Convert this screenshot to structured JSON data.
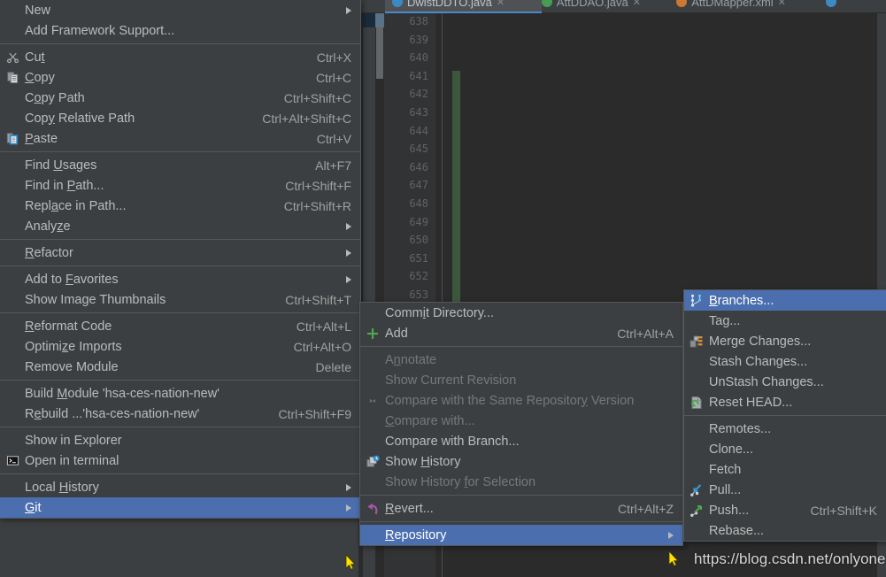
{
  "editor": {
    "tabs": [
      {
        "label": "DwistDDTO.java",
        "icon_color": "#3b8ac4",
        "active": true
      },
      {
        "label": "AttDDAO.java",
        "icon_color": "#499c54",
        "active": false
      },
      {
        "label": "AttDMapper.xml",
        "icon_color": "#cc7832",
        "active": false
      }
    ],
    "line_numbers": [
      "638",
      "639",
      "640",
      "641",
      "642",
      "643",
      "644",
      "645",
      "646",
      "647",
      "648",
      "649",
      "650",
      "651",
      "652",
      "653"
    ]
  },
  "colors": {
    "menu_bg": "#3c3f41",
    "menu_border": "#555759",
    "highlight": "#4b6eaf",
    "text": "#bbbbbb",
    "text_disabled": "#777777",
    "accel": "#a0a0a0",
    "editor_bg": "#2b2b2b",
    "vcs_green": "#3c573c",
    "add_green": "#4fa84f",
    "cursor_yellow": "#ffe100"
  },
  "context_menu": {
    "groups": [
      {
        "items": [
          {
            "label": "New",
            "accel": "",
            "icon": "",
            "submenu": true,
            "disabled": false,
            "selected": false,
            "mnemonic": ""
          },
          {
            "label": "Add Framework Support...",
            "accel": "",
            "icon": "",
            "submenu": false,
            "disabled": false,
            "selected": false,
            "mnemonic": ""
          }
        ]
      },
      {
        "items": [
          {
            "label": "Cut",
            "accel": "Ctrl+X",
            "icon": "scissors-icon",
            "submenu": false,
            "disabled": false,
            "selected": false,
            "mnemonic": "t"
          },
          {
            "label": "Copy",
            "accel": "Ctrl+C",
            "icon": "copy-icon",
            "submenu": false,
            "disabled": false,
            "selected": false,
            "mnemonic": "C"
          },
          {
            "label": "Copy Path",
            "accel": "Ctrl+Shift+C",
            "icon": "",
            "submenu": false,
            "disabled": false,
            "selected": false,
            "mnemonic": "o"
          },
          {
            "label": "Copy Relative Path",
            "accel": "Ctrl+Alt+Shift+C",
            "icon": "",
            "submenu": false,
            "disabled": false,
            "selected": false,
            "mnemonic": "y"
          },
          {
            "label": "Paste",
            "accel": "Ctrl+V",
            "icon": "paste-icon",
            "submenu": false,
            "disabled": false,
            "selected": false,
            "mnemonic": "P"
          }
        ]
      },
      {
        "items": [
          {
            "label": "Find Usages",
            "accel": "Alt+F7",
            "icon": "",
            "submenu": false,
            "disabled": false,
            "selected": false,
            "mnemonic": "U"
          },
          {
            "label": "Find in Path...",
            "accel": "Ctrl+Shift+F",
            "icon": "",
            "submenu": false,
            "disabled": false,
            "selected": false,
            "mnemonic": "P"
          },
          {
            "label": "Replace in Path...",
            "accel": "Ctrl+Shift+R",
            "icon": "",
            "submenu": false,
            "disabled": false,
            "selected": false,
            "mnemonic": "a"
          },
          {
            "label": "Analyze",
            "accel": "",
            "icon": "",
            "submenu": true,
            "disabled": false,
            "selected": false,
            "mnemonic": "z"
          }
        ]
      },
      {
        "items": [
          {
            "label": "Refactor",
            "accel": "",
            "icon": "",
            "submenu": true,
            "disabled": false,
            "selected": false,
            "mnemonic": "R"
          }
        ]
      },
      {
        "items": [
          {
            "label": "Add to Favorites",
            "accel": "",
            "icon": "",
            "submenu": true,
            "disabled": false,
            "selected": false,
            "mnemonic": "F"
          },
          {
            "label": "Show Image Thumbnails",
            "accel": "Ctrl+Shift+T",
            "icon": "",
            "submenu": false,
            "disabled": false,
            "selected": false,
            "mnemonic": ""
          }
        ]
      },
      {
        "items": [
          {
            "label": "Reformat Code",
            "accel": "Ctrl+Alt+L",
            "icon": "",
            "submenu": false,
            "disabled": false,
            "selected": false,
            "mnemonic": "R"
          },
          {
            "label": "Optimize Imports",
            "accel": "Ctrl+Alt+O",
            "icon": "",
            "submenu": false,
            "disabled": false,
            "selected": false,
            "mnemonic": "z"
          },
          {
            "label": "Remove Module",
            "accel": "Delete",
            "icon": "",
            "submenu": false,
            "disabled": false,
            "selected": false,
            "mnemonic": ""
          }
        ]
      },
      {
        "items": [
          {
            "label": "Build Module 'hsa-ces-nation-new'",
            "accel": "",
            "icon": "",
            "submenu": false,
            "disabled": false,
            "selected": false,
            "mnemonic": "M"
          },
          {
            "label": "Rebuild ...'hsa-ces-nation-new'",
            "accel": "Ctrl+Shift+F9",
            "icon": "",
            "submenu": false,
            "disabled": false,
            "selected": false,
            "mnemonic": "e"
          }
        ]
      },
      {
        "items": [
          {
            "label": "Show in Explorer",
            "accel": "",
            "icon": "",
            "submenu": false,
            "disabled": false,
            "selected": false,
            "mnemonic": ""
          },
          {
            "label": "Open in terminal",
            "accel": "",
            "icon": "terminal-icon",
            "submenu": false,
            "disabled": false,
            "selected": false,
            "mnemonic": ""
          }
        ]
      },
      {
        "items": [
          {
            "label": "Local History",
            "accel": "",
            "icon": "",
            "submenu": true,
            "disabled": false,
            "selected": false,
            "mnemonic": "H"
          },
          {
            "label": "Git",
            "accel": "",
            "icon": "",
            "submenu": true,
            "disabled": false,
            "selected": true,
            "mnemonic": "G"
          }
        ]
      }
    ]
  },
  "git_menu": {
    "groups": [
      {
        "items": [
          {
            "label": "Commit Directory...",
            "accel": "",
            "icon": "",
            "submenu": false,
            "disabled": false,
            "selected": false,
            "mnemonic": "i"
          },
          {
            "label": "Add",
            "accel": "Ctrl+Alt+A",
            "icon": "plus-icon",
            "submenu": false,
            "disabled": false,
            "selected": false,
            "mnemonic": ""
          }
        ]
      },
      {
        "items": [
          {
            "label": "Annotate",
            "accel": "",
            "icon": "",
            "submenu": false,
            "disabled": true,
            "selected": false,
            "mnemonic": "n"
          },
          {
            "label": "Show Current Revision",
            "accel": "",
            "icon": "",
            "submenu": false,
            "disabled": true,
            "selected": false,
            "mnemonic": ""
          },
          {
            "label": "Compare with the Same Repository Version",
            "accel": "",
            "icon": "compare-icon",
            "submenu": false,
            "disabled": true,
            "selected": false,
            "mnemonic": "y"
          },
          {
            "label": "Compare with...",
            "accel": "",
            "icon": "",
            "submenu": false,
            "disabled": true,
            "selected": false,
            "mnemonic": "C"
          },
          {
            "label": "Compare with Branch...",
            "accel": "",
            "icon": "",
            "submenu": false,
            "disabled": false,
            "selected": false,
            "mnemonic": ""
          },
          {
            "label": "Show History",
            "accel": "",
            "icon": "history-icon",
            "submenu": false,
            "disabled": false,
            "selected": false,
            "mnemonic": "H"
          },
          {
            "label": "Show History for Selection",
            "accel": "",
            "icon": "",
            "submenu": false,
            "disabled": true,
            "selected": false,
            "mnemonic": "f"
          }
        ]
      },
      {
        "items": [
          {
            "label": "Revert...",
            "accel": "Ctrl+Alt+Z",
            "icon": "revert-icon",
            "submenu": false,
            "disabled": false,
            "selected": false,
            "mnemonic": "R"
          }
        ]
      },
      {
        "items": [
          {
            "label": "Repository",
            "accel": "",
            "icon": "",
            "submenu": true,
            "disabled": false,
            "selected": true,
            "mnemonic": "R"
          }
        ]
      }
    ]
  },
  "repository_menu": {
    "groups": [
      {
        "items": [
          {
            "label": "Branches...",
            "accel": "",
            "icon": "branches-icon",
            "submenu": false,
            "disabled": false,
            "selected": true,
            "mnemonic": "B"
          },
          {
            "label": "Tag...",
            "accel": "",
            "icon": "",
            "submenu": false,
            "disabled": false,
            "selected": false,
            "mnemonic": ""
          },
          {
            "label": "Merge Changes...",
            "accel": "",
            "icon": "merge-icon",
            "submenu": false,
            "disabled": false,
            "selected": false,
            "mnemonic": ""
          },
          {
            "label": "Stash Changes...",
            "accel": "",
            "icon": "",
            "submenu": false,
            "disabled": false,
            "selected": false,
            "mnemonic": ""
          },
          {
            "label": "UnStash Changes...",
            "accel": "",
            "icon": "",
            "submenu": false,
            "disabled": false,
            "selected": false,
            "mnemonic": ""
          },
          {
            "label": "Reset HEAD...",
            "accel": "",
            "icon": "reset-icon",
            "submenu": false,
            "disabled": false,
            "selected": false,
            "mnemonic": ""
          }
        ]
      },
      {
        "items": [
          {
            "label": "Remotes...",
            "accel": "",
            "icon": "",
            "submenu": false,
            "disabled": false,
            "selected": false,
            "mnemonic": ""
          },
          {
            "label": "Clone...",
            "accel": "",
            "icon": "",
            "submenu": false,
            "disabled": false,
            "selected": false,
            "mnemonic": ""
          },
          {
            "label": "Fetch",
            "accel": "",
            "icon": "",
            "submenu": false,
            "disabled": false,
            "selected": false,
            "mnemonic": ""
          },
          {
            "label": "Pull...",
            "accel": "",
            "icon": "pull-icon",
            "submenu": false,
            "disabled": false,
            "selected": false,
            "mnemonic": ""
          },
          {
            "label": "Push...",
            "accel": "Ctrl+Shift+K",
            "icon": "push-icon",
            "submenu": false,
            "disabled": false,
            "selected": false,
            "mnemonic": ""
          },
          {
            "label": "Rebase...",
            "accel": "",
            "icon": "",
            "submenu": false,
            "disabled": false,
            "selected": false,
            "mnemonic": ""
          }
        ]
      }
    ]
  },
  "watermark": {
    "text": "https://blog.csdn.net/onlyone"
  }
}
